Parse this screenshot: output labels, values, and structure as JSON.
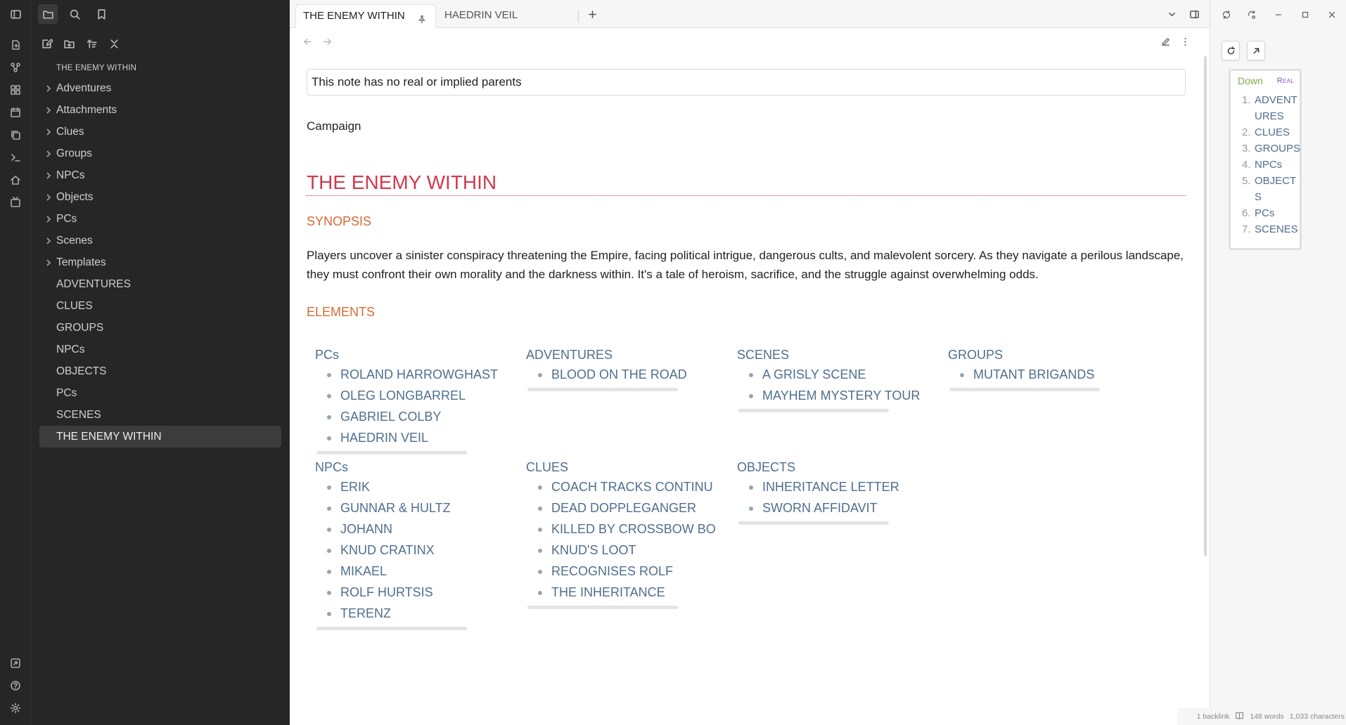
{
  "sidebar": {
    "vault_name": "THE ENEMY WITHIN",
    "folders": [
      "Adventures",
      "Attachments",
      "Clues",
      "Groups",
      "NPCs",
      "Objects",
      "PCs",
      "Scenes",
      "Templates"
    ],
    "files": [
      "ADVENTURES",
      "CLUES",
      "GROUPS",
      "NPCs",
      "OBJECTS",
      "PCs",
      "SCENES",
      "THE ENEMY WITHIN"
    ],
    "active_file": "THE ENEMY WITHIN"
  },
  "tabs": [
    {
      "label": "THE ENEMY WITHIN",
      "active": true,
      "pinned": true
    },
    {
      "label": "HAEDRIN VEIL",
      "active": false
    }
  ],
  "note": {
    "parents_message": "This note has no real or implied parents",
    "tag": "Campaign",
    "title": "THE ENEMY WITHIN",
    "synopsis_heading": "SYNOPSIS",
    "synopsis": "Players uncover a sinister conspiracy threatening the Empire, facing political intrigue, dangerous cults, and malevolent sorcery. As they navigate a perilous landscape, they must confront their own morality and the darkness within. It's a tale of heroism, sacrifice, and the struggle against overwhelming odds.",
    "elements_heading": "ELEMENTS",
    "groups": [
      {
        "title": "PCs",
        "items": [
          "ROLAND HARROWGHAST",
          "OLEG LONGBARREL",
          "GABRIEL COLBY",
          "HAEDRIN VEIL"
        ]
      },
      {
        "title": "ADVENTURES",
        "items": [
          "BLOOD ON THE ROAD"
        ]
      },
      {
        "title": "SCENES",
        "items": [
          "A GRISLY SCENE",
          "MAYHEM MYSTERY TOUR"
        ]
      },
      {
        "title": "GROUPS",
        "items": [
          "MUTANT BRIGANDS"
        ]
      },
      {
        "title": "NPCs",
        "items": [
          "ERIK",
          "GUNNAR & HULTZ",
          "JOHANN",
          "KNUD CRATINX",
          "MIKAEL",
          "ROLF HURTSIS",
          "TERENZ"
        ]
      },
      {
        "title": "CLUES",
        "items": [
          "COACH TRACKS CONTINU",
          "DEAD DOPPLEGANGER",
          "KILLED BY CROSSBOW BO",
          "KNUD'S LOOT",
          "RECOGNISES ROLF",
          "THE INHERITANCE"
        ]
      },
      {
        "title": "OBJECTS",
        "items": [
          "INHERITANCE LETTER",
          "SWORN AFFIDAVIT"
        ]
      }
    ]
  },
  "right_panel": {
    "down_label": "Down",
    "real_label": "Real",
    "items": [
      {
        "num": "1.",
        "label": "ADVENTURES"
      },
      {
        "num": "2.",
        "label": "CLUES"
      },
      {
        "num": "3.",
        "label": "GROUPS"
      },
      {
        "num": "4.",
        "label": "NPCs"
      },
      {
        "num": "5.",
        "label": "OBJECTS"
      },
      {
        "num": "6.",
        "label": "PCs"
      },
      {
        "num": "7.",
        "label": "SCENES"
      }
    ]
  },
  "status_bar": {
    "backlinks": "1 backlink",
    "words": "148 words",
    "characters": "1,033 characters"
  },
  "colors": {
    "heading1": "#d03a4e",
    "heading2": "#d86a32",
    "link": "#4f6e8f",
    "down_label": "#7bb04a",
    "real_label": "#8a56c2"
  }
}
